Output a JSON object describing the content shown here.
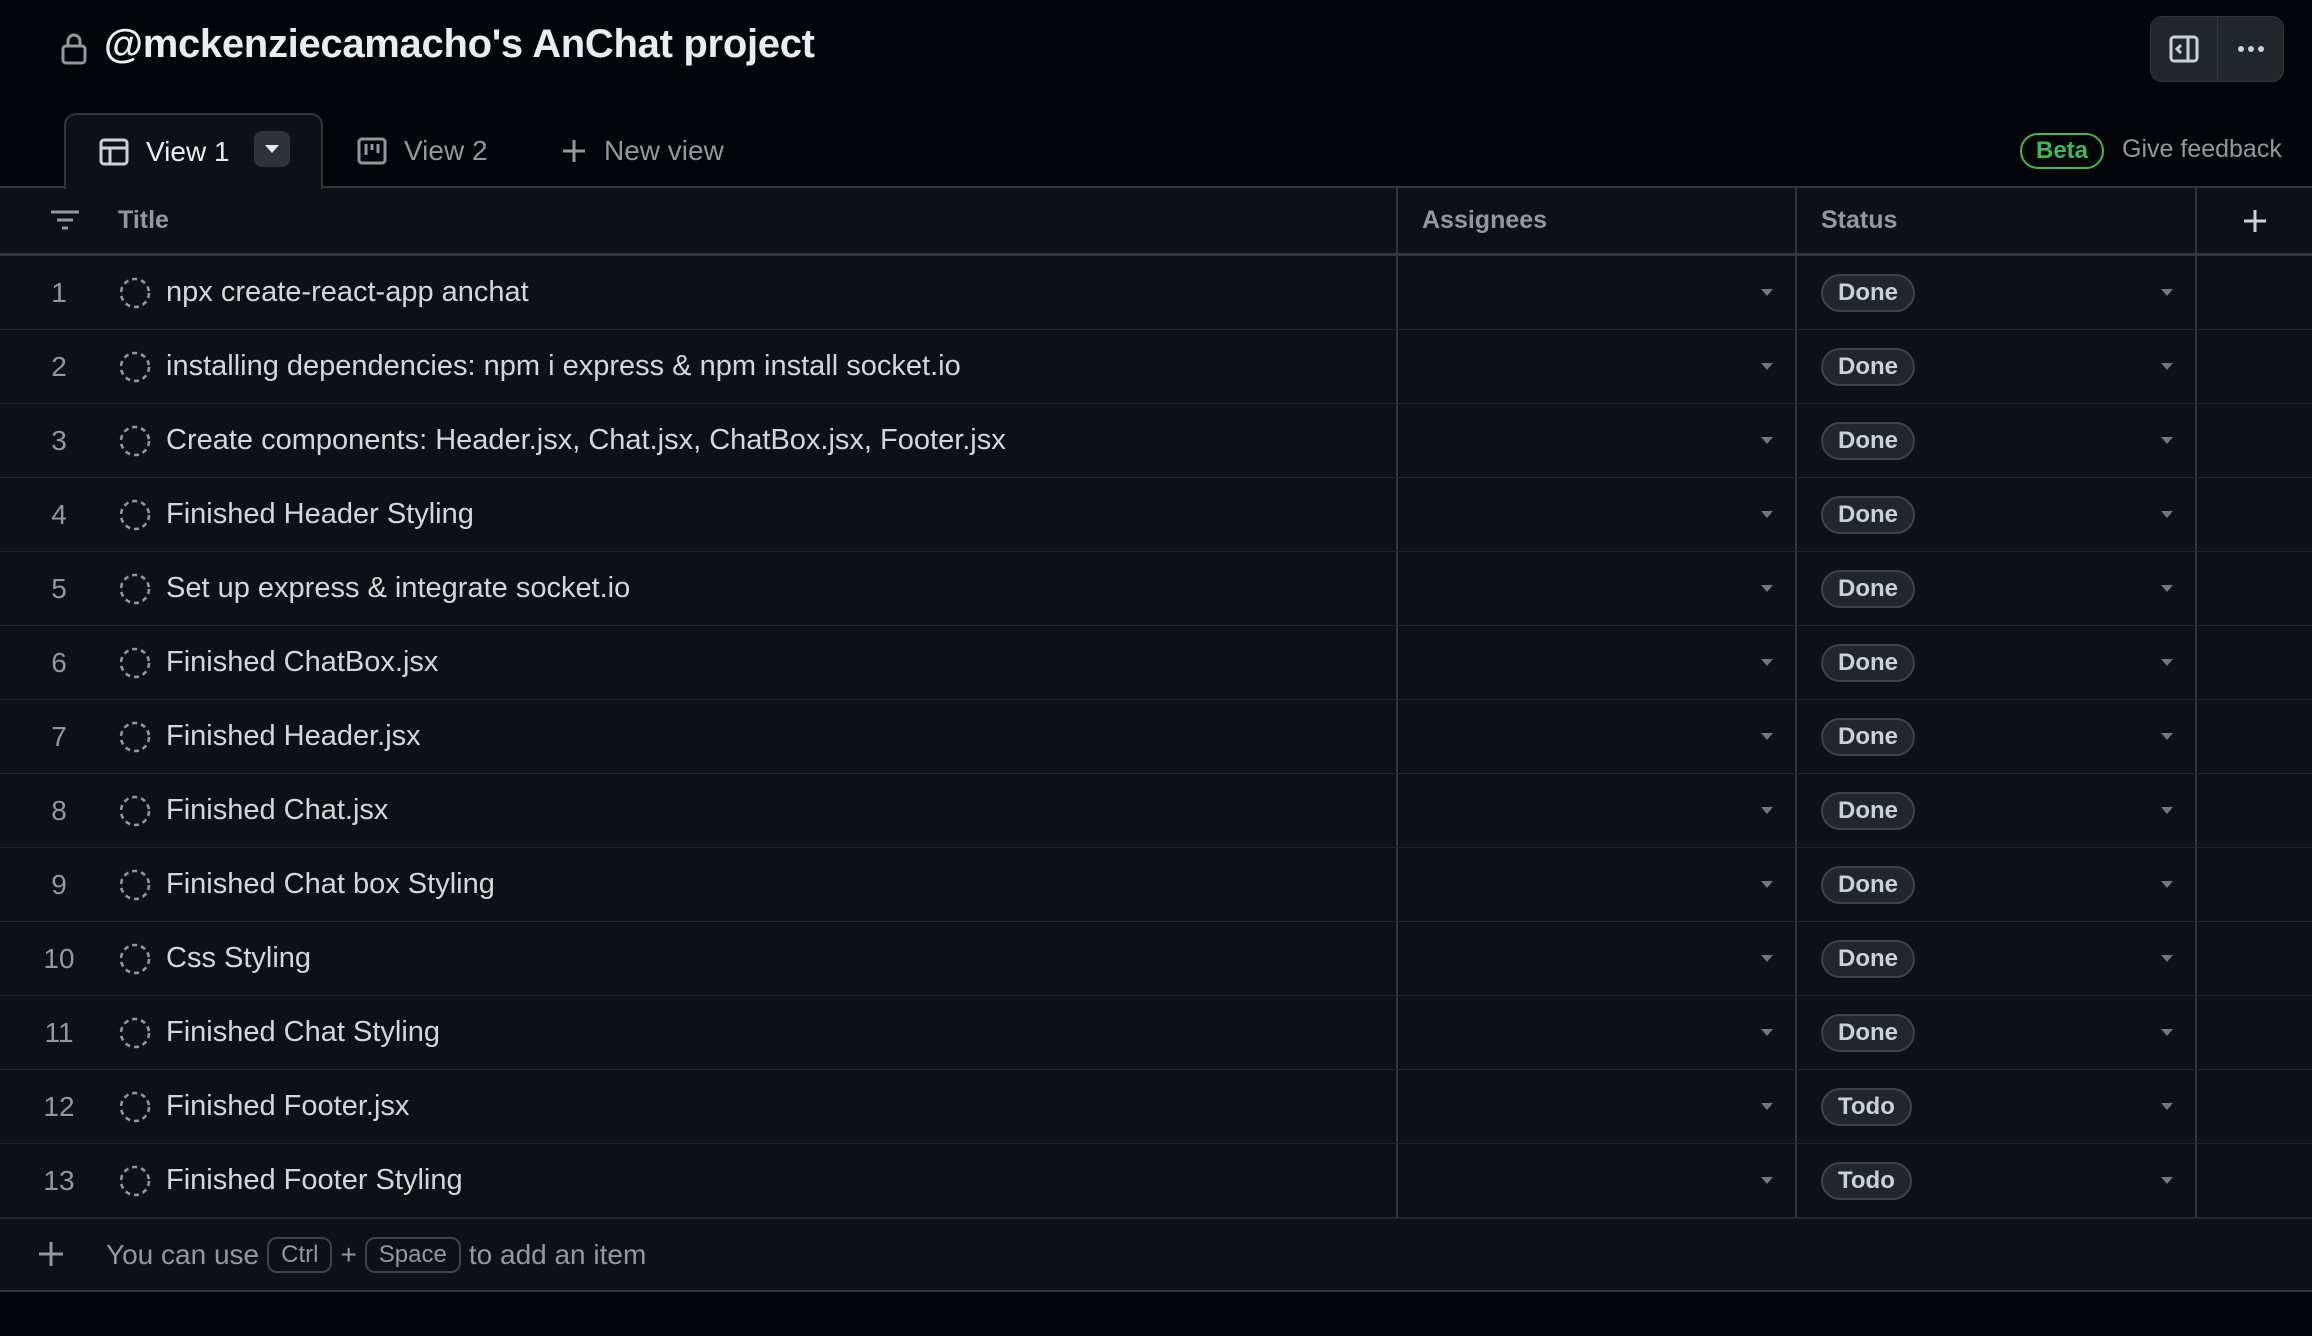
{
  "header": {
    "title": "@mckenziecamacho's AnChat project",
    "lock_icon": "lock-icon",
    "buttons": [
      "sidebar-panel-icon",
      "kebab-horizontal-icon"
    ]
  },
  "tabs": [
    {
      "label": "View 1",
      "icon": "table-icon",
      "active": true
    },
    {
      "label": "View 2",
      "icon": "board-icon",
      "active": false
    },
    {
      "label": "New view",
      "icon": "plus-icon",
      "active": false
    }
  ],
  "beta": {
    "label": "Beta",
    "color": "#3fb950"
  },
  "feedback": "Give feedback",
  "columns": {
    "title": "Title",
    "assignees": "Assignees",
    "status": "Status"
  },
  "rows": [
    {
      "num": "1",
      "title": "npx create-react-app anchat",
      "status": "Done"
    },
    {
      "num": "2",
      "title": "installing dependencies: npm i express & npm install socket.io",
      "status": "Done"
    },
    {
      "num": "3",
      "title": "Create components: Header.jsx, Chat.jsx, ChatBox.jsx, Footer.jsx",
      "status": "Done"
    },
    {
      "num": "4",
      "title": "Finished Header Styling",
      "status": "Done"
    },
    {
      "num": "5",
      "title": "Set up express & integrate socket.io",
      "status": "Done"
    },
    {
      "num": "6",
      "title": "Finished ChatBox.jsx",
      "status": "Done"
    },
    {
      "num": "7",
      "title": "Finished Header.jsx",
      "status": "Done"
    },
    {
      "num": "8",
      "title": "Finished Chat.jsx",
      "status": "Done"
    },
    {
      "num": "9",
      "title": "Finished Chat box Styling",
      "status": "Done"
    },
    {
      "num": "10",
      "title": "Css Styling",
      "status": "Done"
    },
    {
      "num": "11",
      "title": "Finished Chat Styling",
      "status": "Done"
    },
    {
      "num": "12",
      "title": "Finished Footer.jsx",
      "status": "Todo"
    },
    {
      "num": "13",
      "title": "Finished Footer Styling",
      "status": "Todo"
    }
  ],
  "footer": {
    "hint_prefix": "You can use",
    "key1": "Ctrl",
    "plus": "+",
    "key2": "Space",
    "hint_suffix": "to add an item"
  }
}
